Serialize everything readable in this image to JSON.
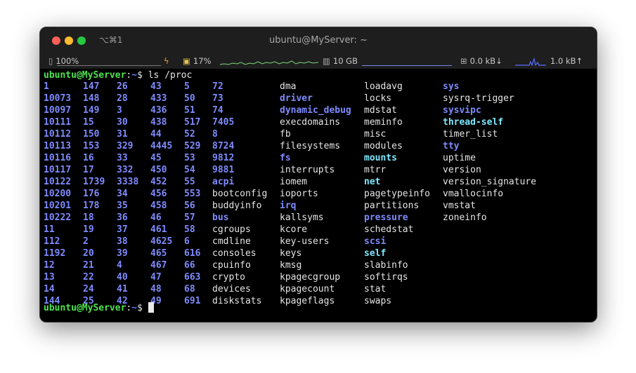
{
  "window": {
    "shortcut": "⌥⌘1",
    "title": "ubuntu@MyServer: ~"
  },
  "statusbar": {
    "battery": "100%",
    "cpu": "17%",
    "memory": "10 GB",
    "net_down": "0.0 kB↓",
    "net_up": "1.0 kB↑"
  },
  "prompt": {
    "user": "ubuntu@MyServer",
    "sep": ":",
    "path": "~",
    "dollar": "$ ",
    "command": "ls /proc"
  },
  "listing": {
    "columns": [
      [
        [
          "1",
          "num"
        ],
        [
          "10073",
          "num"
        ],
        [
          "10097",
          "num"
        ],
        [
          "10111",
          "num"
        ],
        [
          "10112",
          "num"
        ],
        [
          "10113",
          "num"
        ],
        [
          "10116",
          "num"
        ],
        [
          "10117",
          "num"
        ],
        [
          "10122",
          "num"
        ],
        [
          "10200",
          "num"
        ],
        [
          "10201",
          "num"
        ],
        [
          "10222",
          "num"
        ],
        [
          "11",
          "num"
        ],
        [
          "112",
          "num"
        ],
        [
          "1192",
          "num"
        ],
        [
          "12",
          "num"
        ],
        [
          "13",
          "num"
        ],
        [
          "14",
          "num"
        ],
        [
          "144",
          "num"
        ]
      ],
      [
        [
          "147",
          "num"
        ],
        [
          "148",
          "num"
        ],
        [
          "149",
          "num"
        ],
        [
          "15",
          "num"
        ],
        [
          "150",
          "num"
        ],
        [
          "153",
          "num"
        ],
        [
          "16",
          "num"
        ],
        [
          "17",
          "num"
        ],
        [
          "1739",
          "num"
        ],
        [
          "176",
          "num"
        ],
        [
          "178",
          "num"
        ],
        [
          "18",
          "num"
        ],
        [
          "19",
          "num"
        ],
        [
          "2",
          "num"
        ],
        [
          "20",
          "num"
        ],
        [
          "21",
          "num"
        ],
        [
          "22",
          "num"
        ],
        [
          "24",
          "num"
        ],
        [
          "25",
          "num"
        ]
      ],
      [
        [
          "26",
          "num"
        ],
        [
          "28",
          "num"
        ],
        [
          "3",
          "num"
        ],
        [
          "30",
          "num"
        ],
        [
          "31",
          "num"
        ],
        [
          "329",
          "num"
        ],
        [
          "33",
          "num"
        ],
        [
          "332",
          "num"
        ],
        [
          "3338",
          "num"
        ],
        [
          "34",
          "num"
        ],
        [
          "35",
          "num"
        ],
        [
          "36",
          "num"
        ],
        [
          "37",
          "num"
        ],
        [
          "38",
          "num"
        ],
        [
          "39",
          "num"
        ],
        [
          "4",
          "num"
        ],
        [
          "40",
          "num"
        ],
        [
          "41",
          "num"
        ],
        [
          "42",
          "num"
        ]
      ],
      [
        [
          "43",
          "num"
        ],
        [
          "433",
          "num"
        ],
        [
          "436",
          "num"
        ],
        [
          "438",
          "num"
        ],
        [
          "44",
          "num"
        ],
        [
          "4445",
          "num"
        ],
        [
          "45",
          "num"
        ],
        [
          "450",
          "num"
        ],
        [
          "452",
          "num"
        ],
        [
          "456",
          "num"
        ],
        [
          "458",
          "num"
        ],
        [
          "46",
          "num"
        ],
        [
          "461",
          "num"
        ],
        [
          "4625",
          "num"
        ],
        [
          "465",
          "num"
        ],
        [
          "467",
          "num"
        ],
        [
          "47",
          "num"
        ],
        [
          "48",
          "num"
        ],
        [
          "49",
          "num"
        ]
      ],
      [
        [
          "5",
          "num"
        ],
        [
          "50",
          "num"
        ],
        [
          "51",
          "num"
        ],
        [
          "517",
          "num"
        ],
        [
          "52",
          "num"
        ],
        [
          "529",
          "num"
        ],
        [
          "53",
          "num"
        ],
        [
          "54",
          "num"
        ],
        [
          "55",
          "num"
        ],
        [
          "553",
          "num"
        ],
        [
          "56",
          "num"
        ],
        [
          "57",
          "num"
        ],
        [
          "58",
          "num"
        ],
        [
          "6",
          "num"
        ],
        [
          "616",
          "num"
        ],
        [
          "66",
          "num"
        ],
        [
          "663",
          "num"
        ],
        [
          "68",
          "num"
        ],
        [
          "691",
          "num"
        ]
      ],
      [
        [
          "72",
          "num"
        ],
        [
          "73",
          "num"
        ],
        [
          "74",
          "num"
        ],
        [
          "7405",
          "num"
        ],
        [
          "8",
          "num"
        ],
        [
          "8724",
          "num"
        ],
        [
          "9812",
          "num"
        ],
        [
          "9881",
          "num"
        ],
        [
          "acpi",
          "dir"
        ],
        [
          "bootconfig",
          "file"
        ],
        [
          "buddyinfo",
          "file"
        ],
        [
          "bus",
          "dir"
        ],
        [
          "cgroups",
          "file"
        ],
        [
          "cmdline",
          "file"
        ],
        [
          "consoles",
          "file"
        ],
        [
          "cpuinfo",
          "file"
        ],
        [
          "crypto",
          "file"
        ],
        [
          "devices",
          "file"
        ],
        [
          "diskstats",
          "file"
        ]
      ],
      [
        [
          "dma",
          "file"
        ],
        [
          "driver",
          "dir"
        ],
        [
          "dynamic_debug",
          "dir"
        ],
        [
          "execdomains",
          "file"
        ],
        [
          "fb",
          "file"
        ],
        [
          "filesystems",
          "file"
        ],
        [
          "fs",
          "dir"
        ],
        [
          "interrupts",
          "file"
        ],
        [
          "iomem",
          "file"
        ],
        [
          "ioports",
          "file"
        ],
        [
          "irq",
          "dir"
        ],
        [
          "kallsyms",
          "file"
        ],
        [
          "kcore",
          "file"
        ],
        [
          "key-users",
          "file"
        ],
        [
          "keys",
          "file"
        ],
        [
          "kmsg",
          "file"
        ],
        [
          "kpagecgroup",
          "file"
        ],
        [
          "kpagecount",
          "file"
        ],
        [
          "kpageflags",
          "file"
        ]
      ],
      [
        [
          "loadavg",
          "file"
        ],
        [
          "locks",
          "file"
        ],
        [
          "mdstat",
          "file"
        ],
        [
          "meminfo",
          "file"
        ],
        [
          "misc",
          "file"
        ],
        [
          "modules",
          "file"
        ],
        [
          "mounts",
          "link"
        ],
        [
          "mtrr",
          "file"
        ],
        [
          "net",
          "link"
        ],
        [
          "pagetypeinfo",
          "file"
        ],
        [
          "partitions",
          "file"
        ],
        [
          "pressure",
          "dir"
        ],
        [
          "schedstat",
          "file"
        ],
        [
          "scsi",
          "dir"
        ],
        [
          "self",
          "link"
        ],
        [
          "slabinfo",
          "file"
        ],
        [
          "softirqs",
          "file"
        ],
        [
          "stat",
          "file"
        ],
        [
          "swaps",
          "file"
        ]
      ],
      [
        [
          "sys",
          "dir"
        ],
        [
          "sysrq-trigger",
          "file"
        ],
        [
          "sysvipc",
          "dir"
        ],
        [
          "thread-self",
          "link"
        ],
        [
          "timer_list",
          "file"
        ],
        [
          "tty",
          "dir"
        ],
        [
          "uptime",
          "file"
        ],
        [
          "version",
          "file"
        ],
        [
          "version_signature",
          "file"
        ],
        [
          "vmallocinfo",
          "file"
        ],
        [
          "vmstat",
          "file"
        ],
        [
          "zoneinfo",
          "file"
        ]
      ]
    ]
  }
}
